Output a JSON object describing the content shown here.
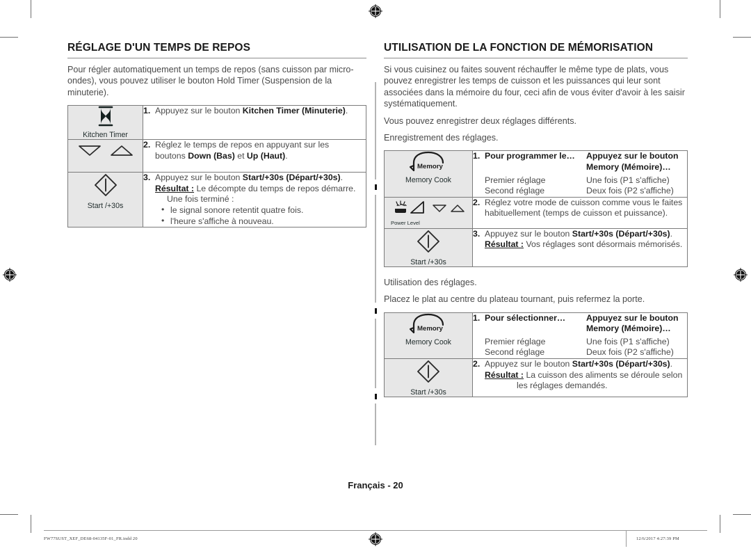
{
  "page": {
    "folio": "Français - 20",
    "indd_filename": "FW77SUST_XEF_DE68-04135F-01_FR.indd   20",
    "indd_timestamp": "12/6/2017   4:27:39 PM"
  },
  "left_column": {
    "title": "RÉGLAGE D'UN TEMPS DE REPOS",
    "intro": "Pour régler automatiquement un temps de repos (sans cuisson par micro-ondes), vous pouvez utiliser le bouton Hold Timer (Suspension de la minuterie).",
    "table": {
      "rows": [
        {
          "icon_name": "hourglass-icon",
          "icon_label": "Kitchen Timer",
          "number": "1.",
          "text_plain": "Appuyez sur le bouton Kitchen Timer (Minuterie)."
        },
        {
          "icon_name": "down-up-arrows-icon",
          "icon_label": "",
          "number": "2.",
          "text_plain": "Réglez le temps de repos en appuyant sur les boutons Down (Bas) et Up (Haut)."
        },
        {
          "icon_name": "start-diamond-icon",
          "icon_label": "Start /+30s",
          "number": "3.",
          "text_plain": "Appuyez sur le bouton Start/+30s (Départ/+30s).",
          "result_label": "Résultat :",
          "result_text": "Le décompte du temps de repos démarre. Une fois terminé :",
          "bullets": [
            "le signal sonore retentit quatre fois.",
            "l'heure s'affiche à nouveau."
          ]
        }
      ]
    }
  },
  "right_column": {
    "title": "UTILISATION DE LA FONCTION DE MÉMORISATION",
    "intro_1": "Si vous cuisinez ou faites souvent réchauffer le même type de plats, vous pouvez enregistrer les temps de cuisson et les puissances qui leur sont associées dans la mémoire du four, ceci afin de vous éviter d'avoir à les saisir systématiquement.",
    "intro_2": "Vous pouvez enregistrer deux réglages différents.",
    "intro_3": "Enregistrement des réglages.",
    "table_record": {
      "rows": [
        {
          "icon_name": "memory-cook-icon",
          "icon_inner_label": "Memory",
          "icon_label": "Memory Cook",
          "number": "1.",
          "head_left": "Pour programmer le…",
          "head_right_l1": "Appuyez sur le bouton",
          "head_right_l2": "Memory (Mémoire)…",
          "pairs": [
            {
              "left": "Premier réglage",
              "right": "Une fois (P1 s'affiche)"
            },
            {
              "left": "Second réglage",
              "right": "Deux fois (P2 s'affiche)"
            }
          ]
        },
        {
          "icon_name": "power-level-icon",
          "icon_label": "Power Level",
          "number": "2.",
          "text_plain": "Réglez votre mode de cuisson comme vous le faites habituellement (temps de cuisson et puissance)."
        },
        {
          "icon_name": "start-diamond-icon",
          "icon_label": "Start /+30s",
          "number": "3.",
          "text_plain": "Appuyez sur le bouton Start/+30s (Départ/+30s).",
          "result_label": "Résultat :",
          "result_text": "Vos réglages sont désormais mémorisés."
        }
      ]
    },
    "mid_1": "Utilisation des réglages.",
    "mid_2": "Placez le plat au centre du plateau tournant, puis refermez la porte.",
    "table_use": {
      "rows": [
        {
          "icon_name": "memory-cook-icon",
          "icon_inner_label": "Memory",
          "icon_label": "Memory Cook",
          "number": "1.",
          "head_left": "Pour sélectionner…",
          "head_right_l1": "Appuyez sur le bouton",
          "head_right_l2": "Memory (Mémoire)…",
          "pairs": [
            {
              "left": "Premier réglage",
              "right": "Une fois (P1 s'affiche)"
            },
            {
              "left": "Second réglage",
              "right": "Deux fois (P2 s'affiche)"
            }
          ]
        },
        {
          "icon_name": "start-diamond-icon",
          "icon_label": "Start /+30s",
          "number": "2.",
          "text_plain": "Appuyez sur le bouton Start/+30s (Départ/+30s).",
          "result_label": "Résultat :",
          "result_text": "La cuisson des aliments se déroule selon",
          "result_text_2": "les réglages demandés."
        }
      ]
    }
  },
  "colors": {
    "rule": "#8d8d8d",
    "icon_cell_bg": "#e7e7e7",
    "table_border": "#7b7b7b",
    "body_text": "#4a4a4a",
    "heading_text": "#1b1b1b"
  }
}
